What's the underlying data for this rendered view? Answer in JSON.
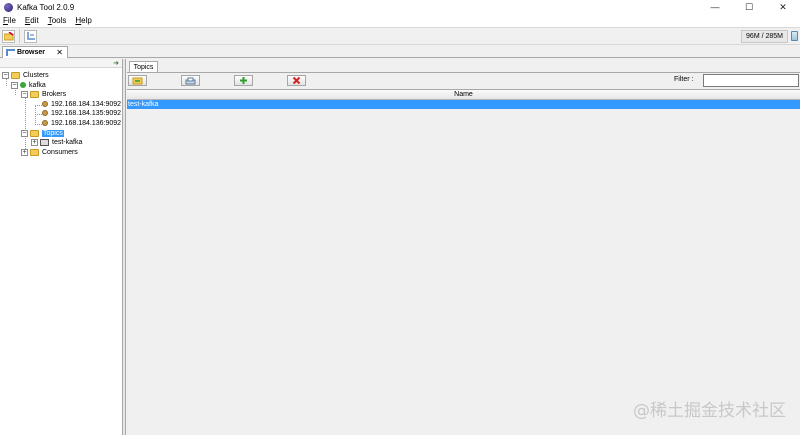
{
  "window": {
    "title": "Kafka Tool  2.0.9",
    "controls": [
      "—",
      "☐",
      "✕"
    ]
  },
  "menu": [
    {
      "underline": "F",
      "rest": "ile"
    },
    {
      "underline": "E",
      "rest": "dit"
    },
    {
      "underline": "T",
      "rest": "ools"
    },
    {
      "underline": "H",
      "rest": "elp"
    }
  ],
  "toolbar": {
    "memory": "96M / 285M"
  },
  "doc_tab": {
    "label": "Browser",
    "close": "✕"
  },
  "tree": {
    "clusters": "Clusters",
    "cluster": "kafka",
    "brokers": "Brokers",
    "broker_list": [
      "192.168.184.134:9092",
      "192.168.184.135:9092",
      "192.168.184.136:9092"
    ],
    "topics": "Topics",
    "topic_list": [
      "test-kafka"
    ],
    "consumers": "Consumers"
  },
  "topics_view": {
    "tab": "Topics",
    "filter_label": "Filter :",
    "filter_value": "",
    "column": "Name",
    "rows": [
      "test-kafka"
    ]
  },
  "watermark": "@稀土掘金技术社区",
  "colors": {
    "selection": "#3399ff",
    "folder": "#f3cd5a",
    "add_green": "#2e9e2e",
    "delete_red": "#d42020"
  }
}
